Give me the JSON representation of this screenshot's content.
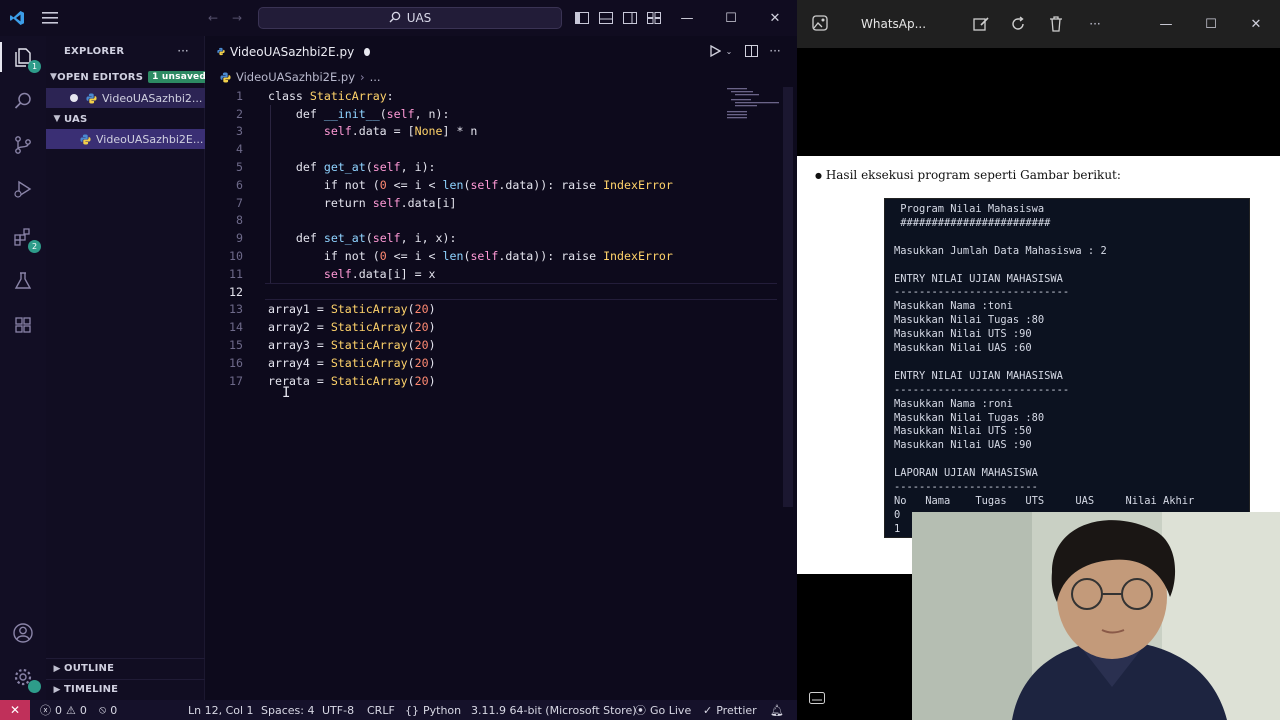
{
  "vscode": {
    "command_center": "UAS",
    "explorer_title": "EXPLORER",
    "open_editors_label": "OPEN EDITORS",
    "unsaved_badge": "1 unsaved",
    "open_file": "VideoUASazhbi2...",
    "folder_label": "UAS",
    "folder_file": "VideoUASazhbi2E...",
    "outline_label": "OUTLINE",
    "timeline_label": "TIMELINE",
    "tab_label": "VideoUASazhbi2E.py",
    "breadcrumb_file": "VideoUASazhbi2E.py",
    "breadcrumb_rest": "...",
    "extensions_badge": "2",
    "accounts_badge": "1",
    "code_lines": [
      {
        "n": "1",
        "text": "class StaticArray:"
      },
      {
        "n": "2",
        "text": "    def __init__(self, n):"
      },
      {
        "n": "3",
        "text": "        self.data = [None] * n"
      },
      {
        "n": "4",
        "text": ""
      },
      {
        "n": "5",
        "text": "    def get_at(self, i):"
      },
      {
        "n": "6",
        "text": "        if not (0 <= i < len(self.data)): raise IndexError"
      },
      {
        "n": "7",
        "text": "        return self.data[i]"
      },
      {
        "n": "8",
        "text": ""
      },
      {
        "n": "9",
        "text": "    def set_at(self, i, x):"
      },
      {
        "n": "10",
        "text": "        if not (0 <= i < len(self.data)): raise IndexError"
      },
      {
        "n": "11",
        "text": "        self.data[i] = x"
      },
      {
        "n": "12",
        "text": ""
      },
      {
        "n": "13",
        "text": "array1 = StaticArray(20)"
      },
      {
        "n": "14",
        "text": "array2 = StaticArray(20)"
      },
      {
        "n": "15",
        "text": "array3 = StaticArray(20)"
      },
      {
        "n": "16",
        "text": "array4 = StaticArray(20)"
      },
      {
        "n": "17",
        "text": "rerata = StaticArray(20)"
      }
    ],
    "status": {
      "errors": "0",
      "warnings": "0",
      "ports": "0",
      "position": "Ln 12, Col 1",
      "spaces": "Spaces: 4",
      "encoding": "UTF-8",
      "eol": "CRLF",
      "language": "Python",
      "interpreter": "3.11.9 64-bit (Microsoft Store)",
      "golive": "Go Live",
      "prettier": "Prettier"
    }
  },
  "viewer": {
    "title": "WhatsAp...",
    "doc_text": "Hasil eksekusi program seperti Gambar berikut:",
    "console_lines": [
      " Program Nilai Mahasiswa",
      " ########################",
      "",
      "Masukkan Jumlah Data Mahasiswa : 2",
      "",
      "ENTRY NILAI UJIAN MAHASISWA",
      "----------------------------",
      "Masukkan Nama :toni",
      "Masukkan Nilai Tugas :80",
      "Masukkan Nilai UTS :90",
      "Masukkan Nilai UAS :60",
      "",
      "ENTRY NILAI UJIAN MAHASISWA",
      "----------------------------",
      "Masukkan Nama :roni",
      "Masukkan Nilai Tugas :80",
      "Masukkan Nilai UTS :50",
      "Masukkan Nilai UAS :90",
      "",
      "LAPORAN UJIAN MAHASISWA",
      "-----------------------",
      "No   Nama    Tugas   UTS     UAS     Nilai Akhir",
      "0",
      "1"
    ]
  }
}
